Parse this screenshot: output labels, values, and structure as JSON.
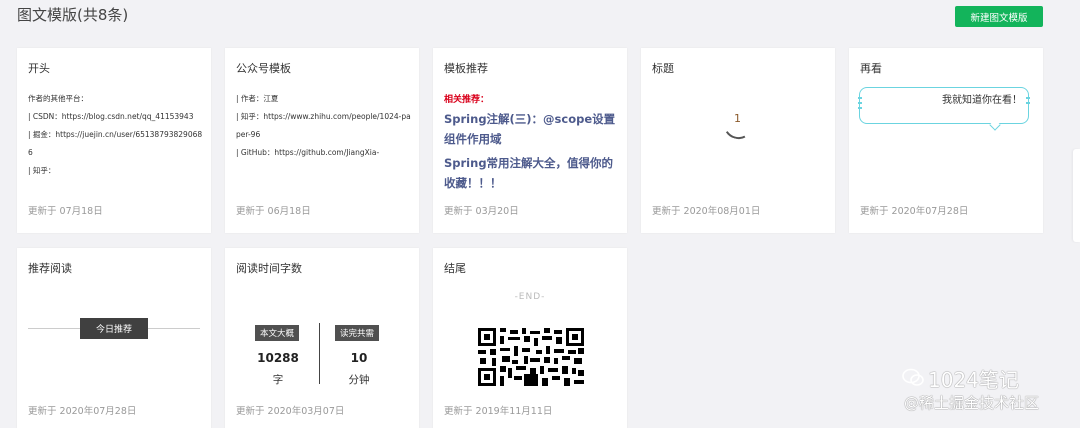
{
  "header": {
    "title": "图文模版(共8条)",
    "new_button": "新建图文模版"
  },
  "cards": [
    {
      "name": "开头",
      "date": "更新于 07月18日",
      "lines": [
        "作者的其他平台：",
        "| CSDN：https://blog.csdn.net/qq_41153943",
        "| 掘金：https://juejin.cn/user/651387938290686",
        "| 知乎："
      ]
    },
    {
      "name": "公众号模板",
      "date": "更新于 06月18日",
      "lines": [
        "| 作者：江夏",
        "| 知乎：https://www.zhihu.com/people/1024-paper-96",
        "| GitHub：https://github.com/JiangXia-"
      ]
    },
    {
      "name": "模板推荐",
      "date": "更新于 03月20日",
      "label": "相关推荐：",
      "links": [
        "Spring注解(三)：@scope设置组件作用域",
        "Spring常用注解大全，值得你的收藏！！！"
      ]
    },
    {
      "name": "标题",
      "date": "更新于 2020年08月01日",
      "number": "1"
    },
    {
      "name": "再看",
      "date": "更新于 2020年07月28日",
      "bubble": "我就知道你在看！"
    },
    {
      "name": "推荐阅读",
      "date": "更新于 2020年07月28日",
      "tag": "今日推荐"
    },
    {
      "name": "阅读时间字数",
      "date": "更新于 2020年03月07日",
      "left_tag": "本文大概",
      "left_num": "10288",
      "left_unit": "字",
      "right_tag": "读完共需",
      "right_num": "10",
      "right_unit": "分钟"
    },
    {
      "name": "结尾",
      "date": "更新于 2019年11月11日",
      "end": "-END-"
    }
  ],
  "watermark": {
    "brand": "1024笔记",
    "sub": "@稀土掘金技术社区"
  }
}
